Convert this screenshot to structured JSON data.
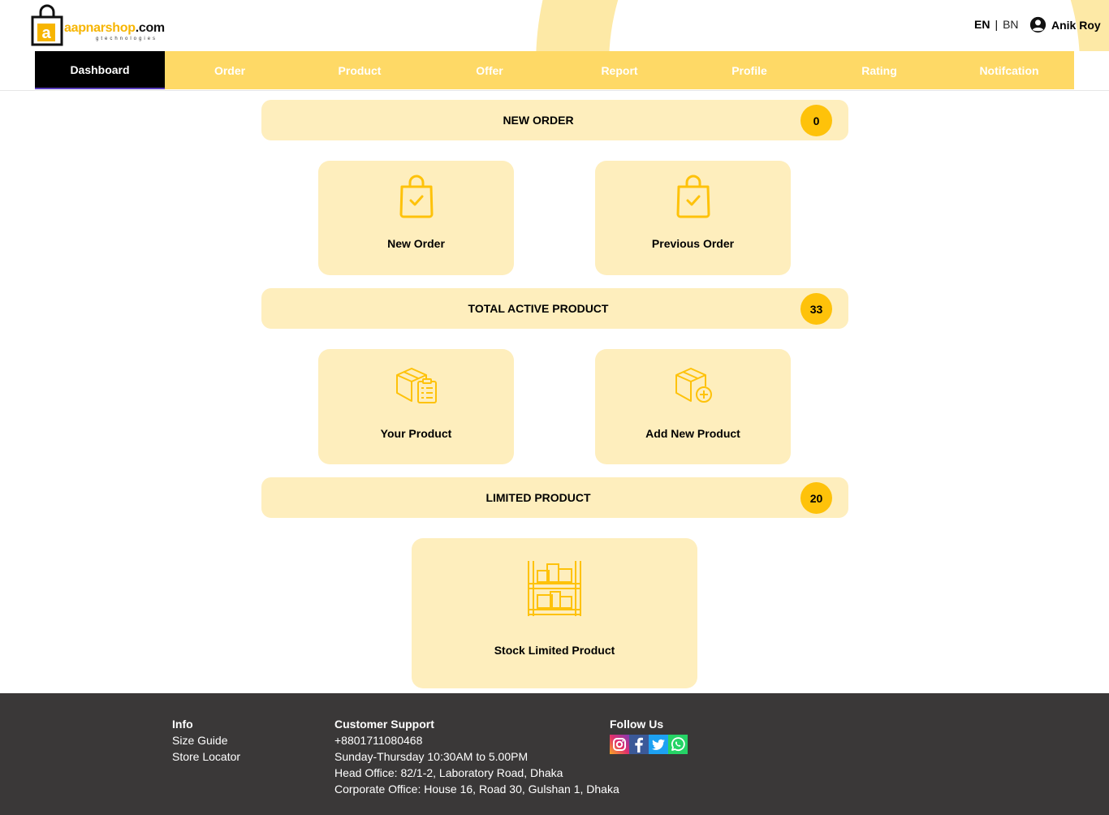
{
  "brand": {
    "name_part1": "aapnarshop",
    "name_part2": ".com",
    "tagline": "gtechnologies"
  },
  "lang": {
    "en": "EN",
    "sep": "|",
    "bn": "BN"
  },
  "user": {
    "name": "Anik Roy"
  },
  "nav": [
    {
      "label": "Dashboard",
      "active": true
    },
    {
      "label": "Order"
    },
    {
      "label": "Product"
    },
    {
      "label": "Offer"
    },
    {
      "label": "Report"
    },
    {
      "label": "Profile"
    },
    {
      "label": "Rating"
    },
    {
      "label": "Notifcation"
    }
  ],
  "sections": {
    "new_order": {
      "title": "NEW ORDER",
      "count": "0"
    },
    "active_product": {
      "title": "TOTAL ACTIVE PRODUCT",
      "count": "33"
    },
    "limited_product": {
      "title": "LIMITED PRODUCT",
      "count": "20"
    }
  },
  "cards": {
    "new_order": "New Order",
    "previous_order": "Previous Order",
    "your_product": "Your Product",
    "add_new_product": "Add New Product",
    "stock_limited": "Stock Limited Product"
  },
  "footer": {
    "info": {
      "title": "Info",
      "links": [
        "Size Guide",
        "Store Locator"
      ]
    },
    "support": {
      "title": "Customer Support",
      "phone": "+8801711080468",
      "hours": "Sunday-Thursday 10:30AM to 5.00PM",
      "head_office": "Head Office: 82/1-2, Laboratory Road, Dhaka",
      "corporate_office": "Corporate Office: House 16, Road 30, Gulshan 1, Dhaka"
    },
    "follow": {
      "title": "Follow Us",
      "icons": [
        "instagram-icon",
        "facebook-icon",
        "twitter-icon",
        "whatsapp-icon"
      ]
    }
  },
  "colors": {
    "accent": "#fec20a",
    "nav_bg": "#fed966",
    "card_bg": "#feeebd",
    "footer_bg": "#3a3838"
  }
}
